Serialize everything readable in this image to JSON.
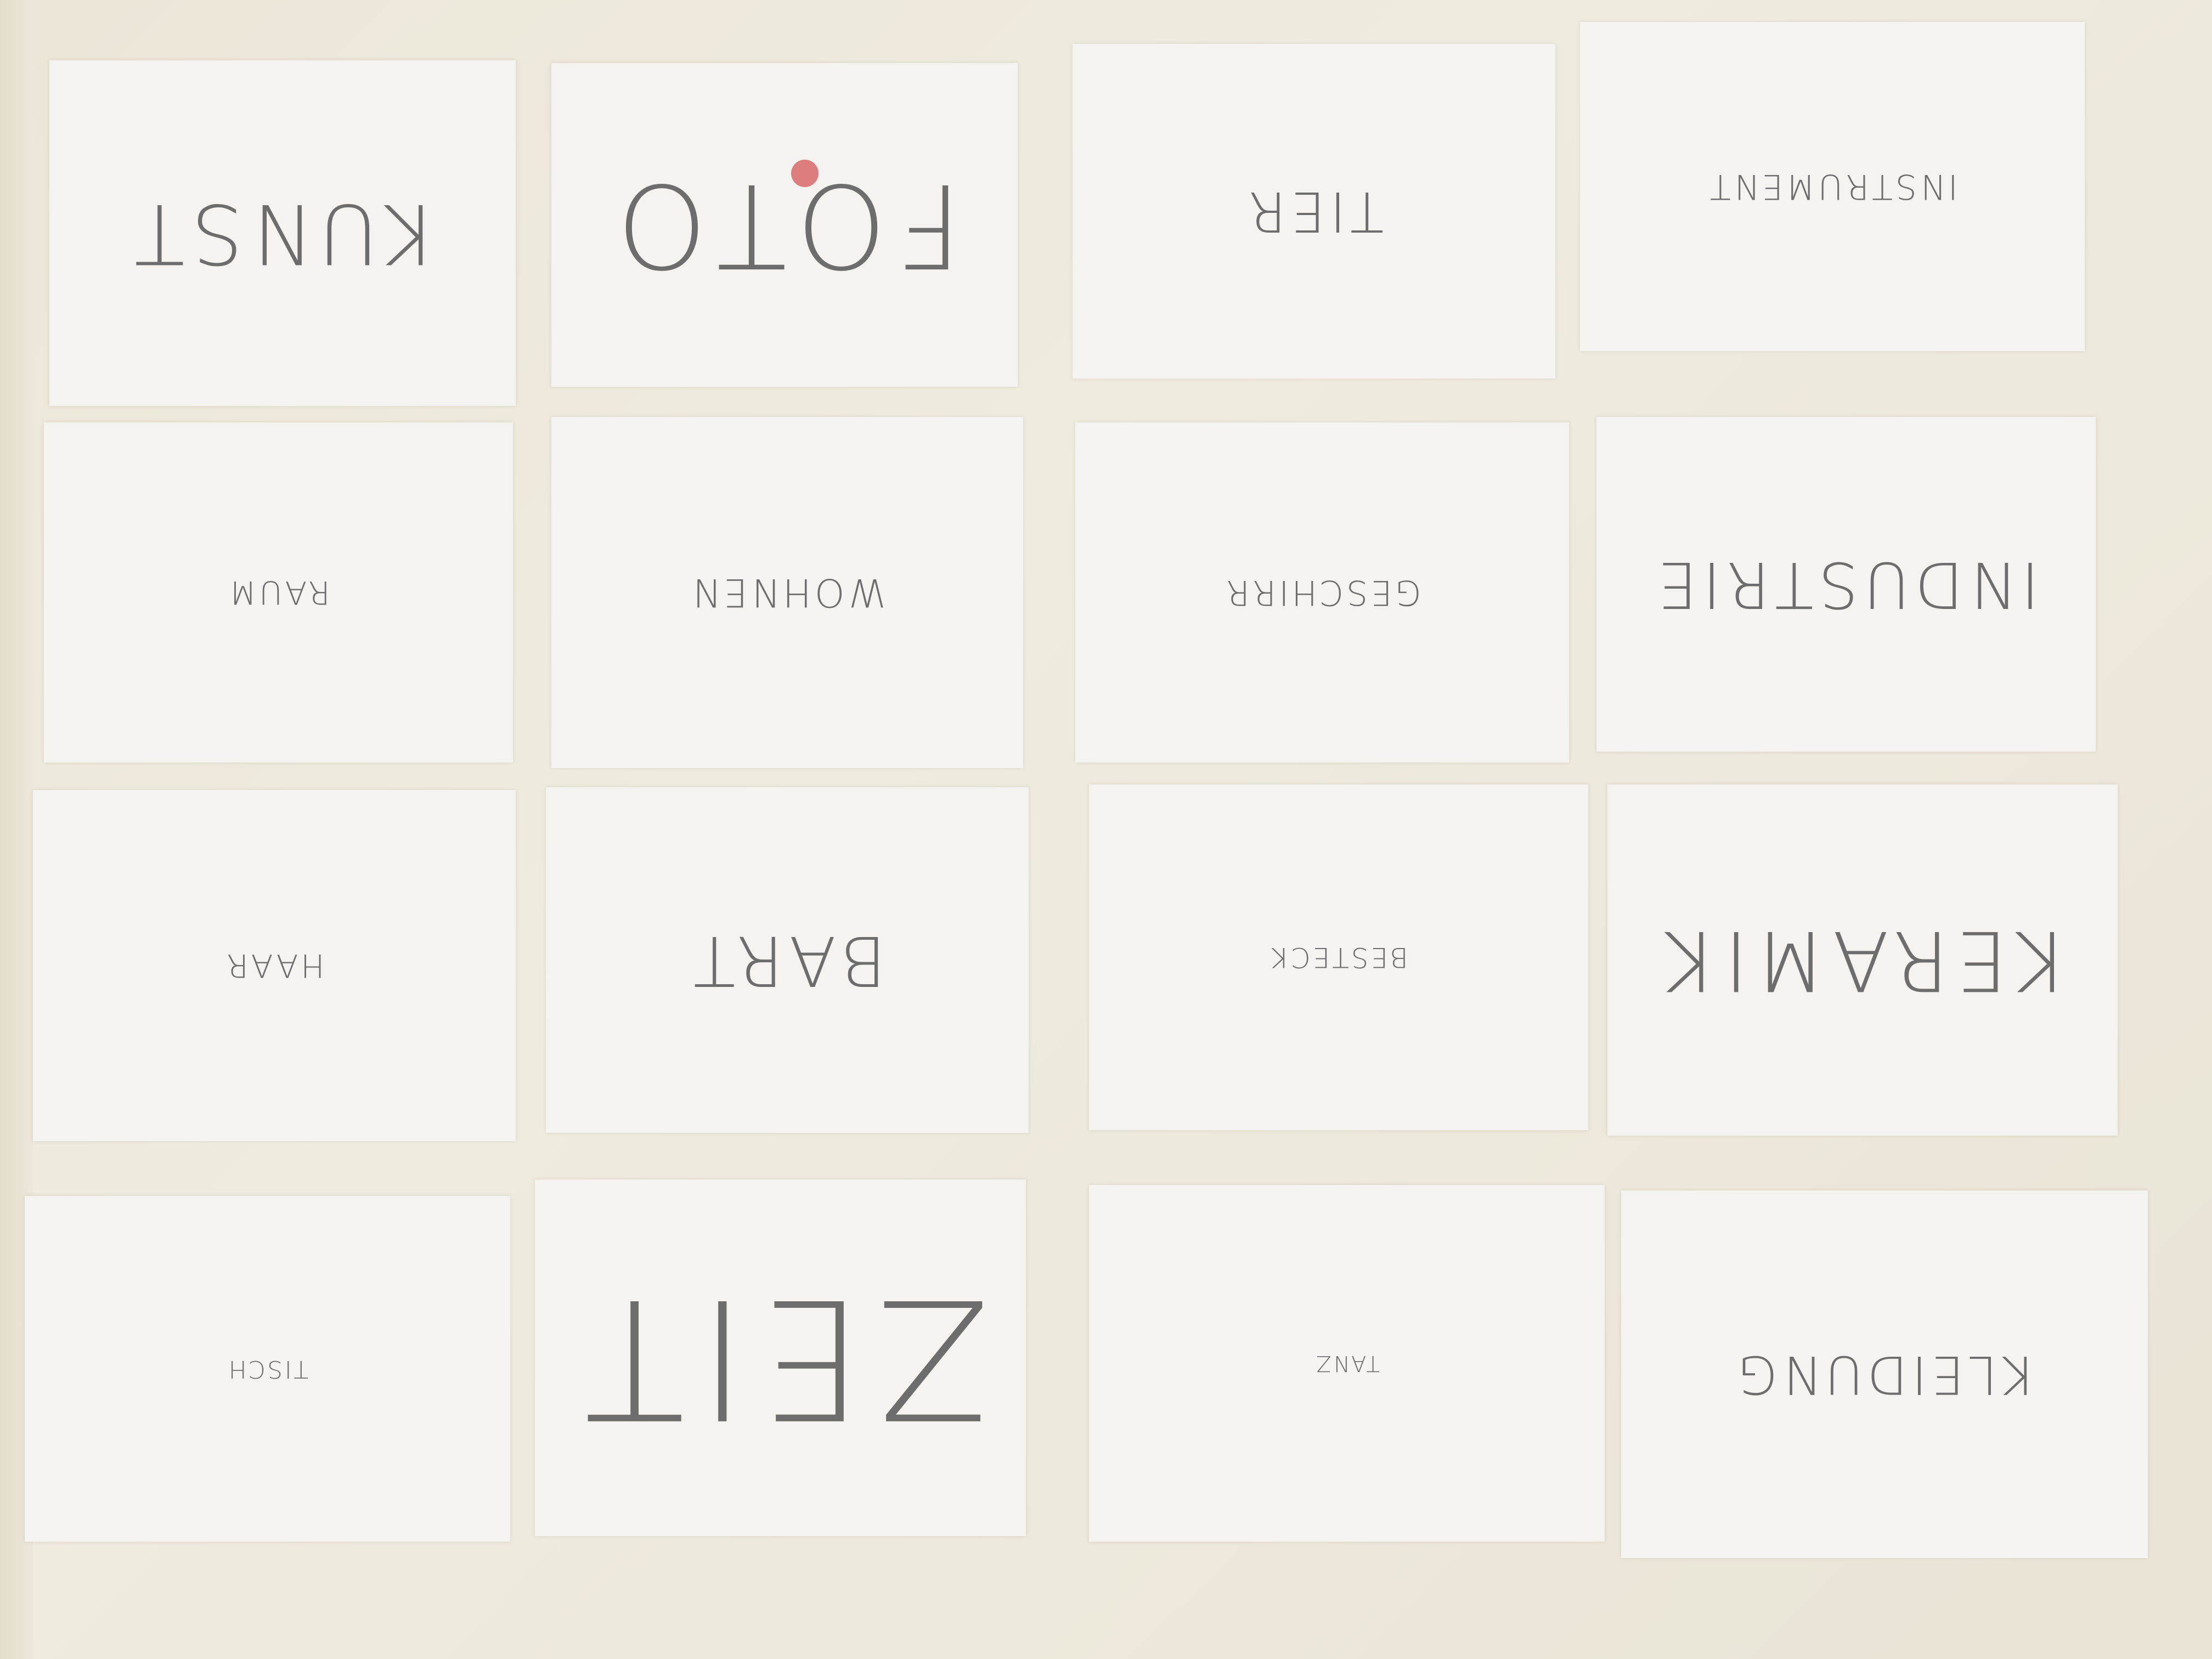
{
  "cards": [
    {
      "word": "KUNST"
    },
    {
      "word": "FOTO"
    },
    {
      "word": "TIER"
    },
    {
      "word": "INSTRUMENT"
    },
    {
      "word": "RAUM"
    },
    {
      "word": "WOHNEN"
    },
    {
      "word": "GESCHIRR"
    },
    {
      "word": "INDUSTRIE"
    },
    {
      "word": "HAAR"
    },
    {
      "word": "BART"
    },
    {
      "word": "BESTECK"
    },
    {
      "word": "KERAMIK"
    },
    {
      "word": "TISCH"
    },
    {
      "word": "ZEIT"
    },
    {
      "word": "TANZ"
    },
    {
      "word": "KLEIDUNG"
    }
  ],
  "colors": {
    "background": "#ece7da",
    "card": "#f4f3ef",
    "ink": "#6d6d6d",
    "marker_dot": "#de7d7d"
  }
}
